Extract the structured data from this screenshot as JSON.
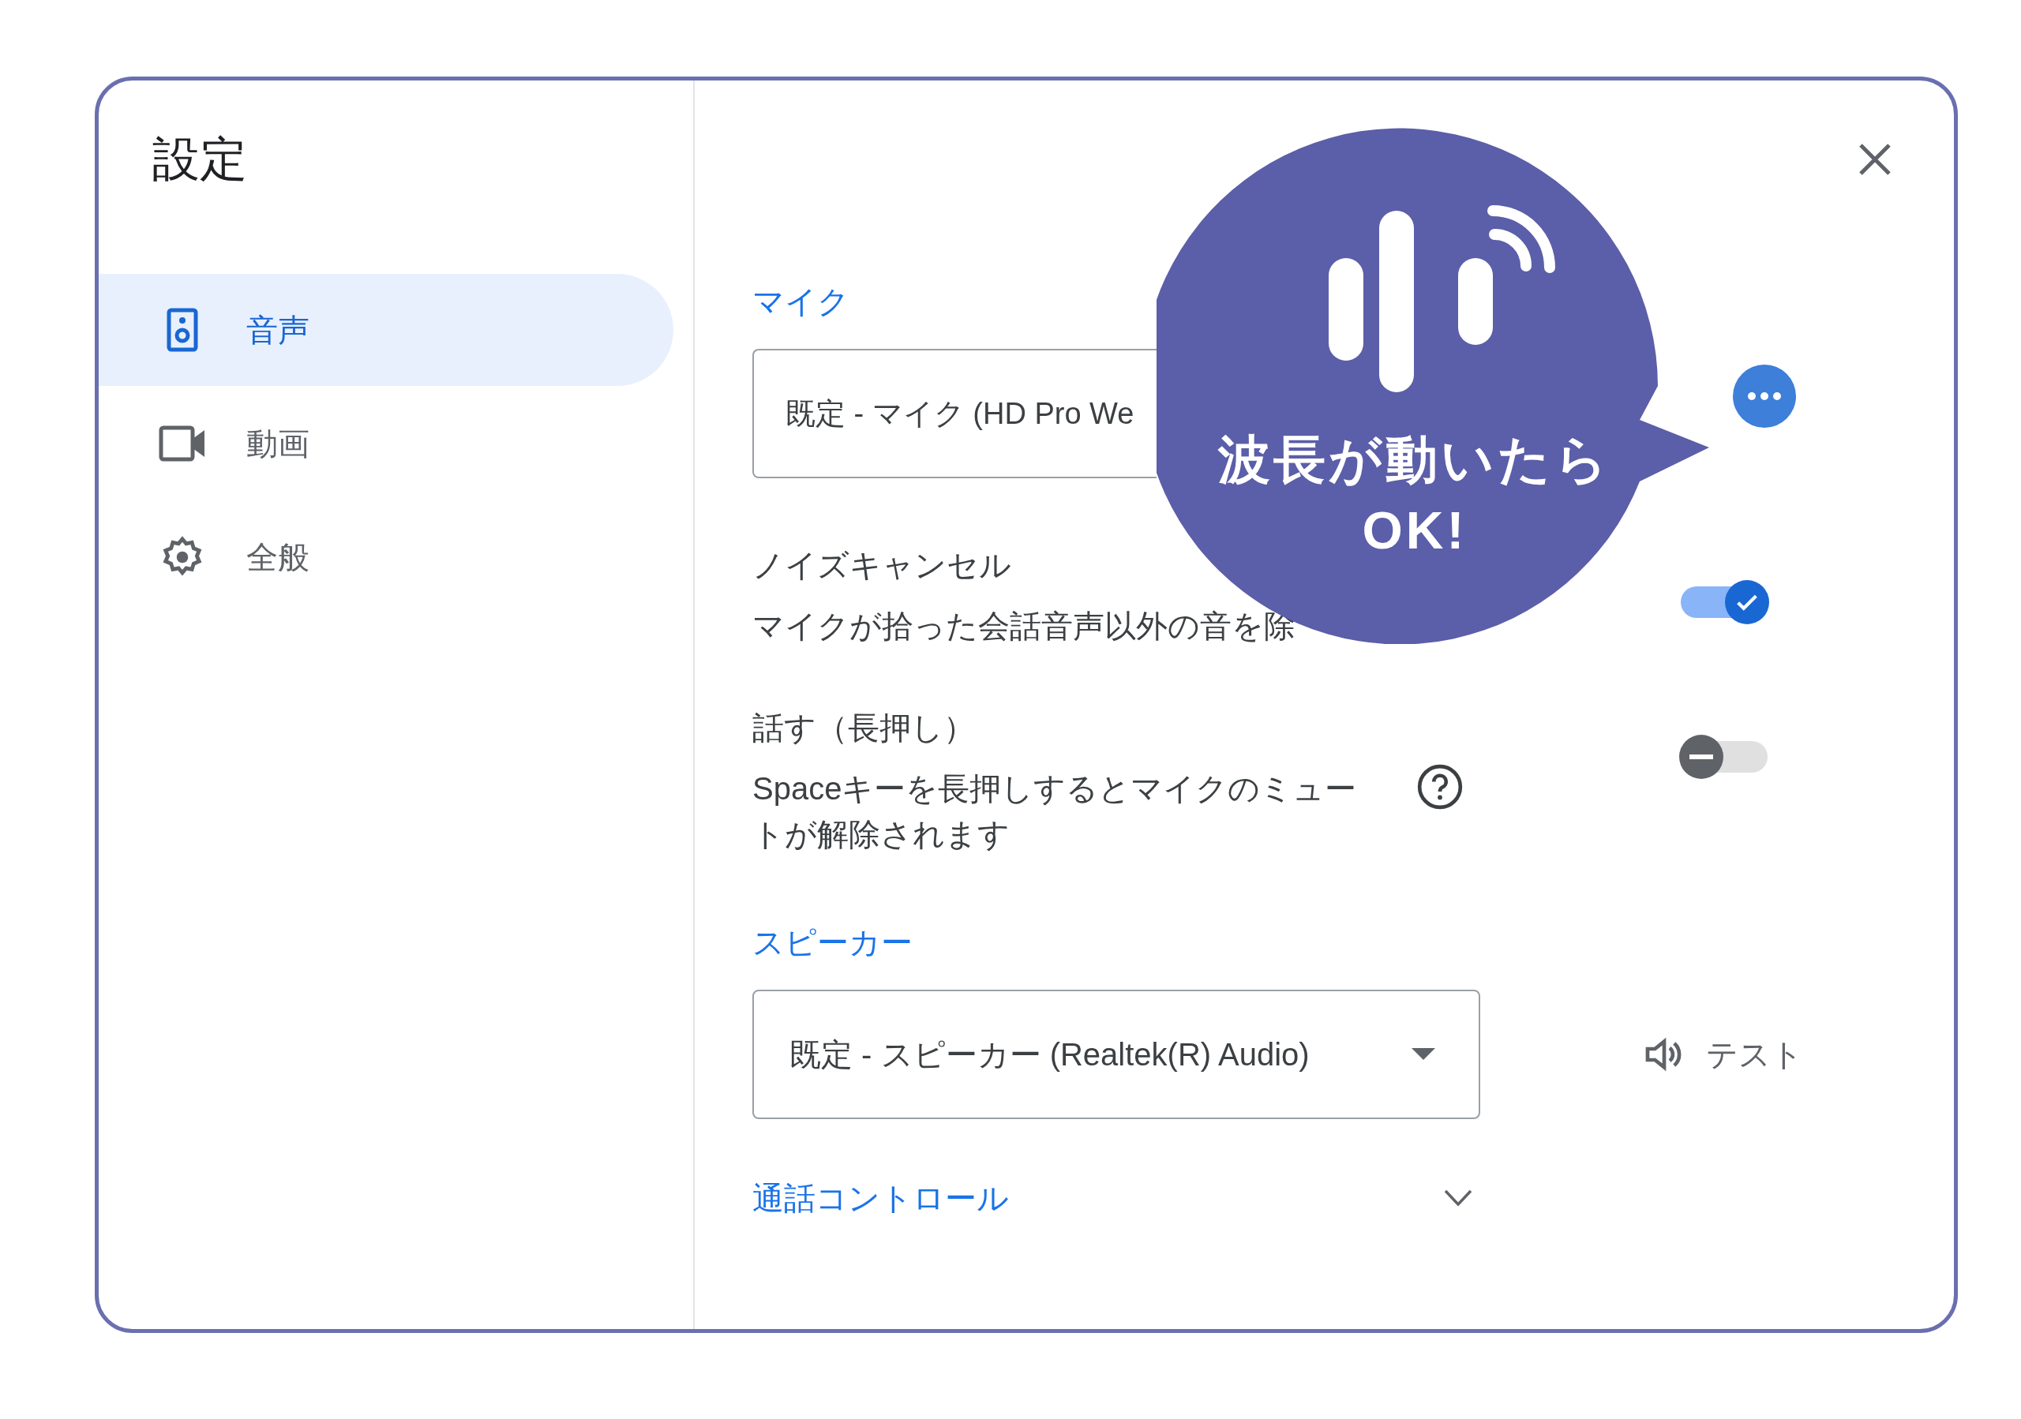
{
  "title": "設定",
  "sidebar": {
    "items": [
      {
        "label": "音声",
        "kind": "speaker",
        "selected": true
      },
      {
        "label": "動画",
        "kind": "video",
        "selected": false
      },
      {
        "label": "全般",
        "kind": "gear",
        "selected": false
      }
    ]
  },
  "microphone": {
    "label": "マイク",
    "device": "既定 - マイク (HD Pro We"
  },
  "settings": [
    {
      "title": "ノイズキャンセル",
      "description": "マイクが拾った会話音声以外の音を除",
      "help": false,
      "on": true
    },
    {
      "title": "話す（長押し）",
      "description": "Spaceキーを長押しするとマイクのミュートが解除されます",
      "help": true,
      "on": false
    }
  ],
  "speaker": {
    "label": "スピーカー",
    "device": "既定 - スピーカー (Realtek(R) Audio)",
    "test": "テスト"
  },
  "call_controls": {
    "label": "通話コントロール",
    "expanded": false
  },
  "callout": {
    "lines": [
      "波長が動いたら",
      "OK!"
    ]
  }
}
